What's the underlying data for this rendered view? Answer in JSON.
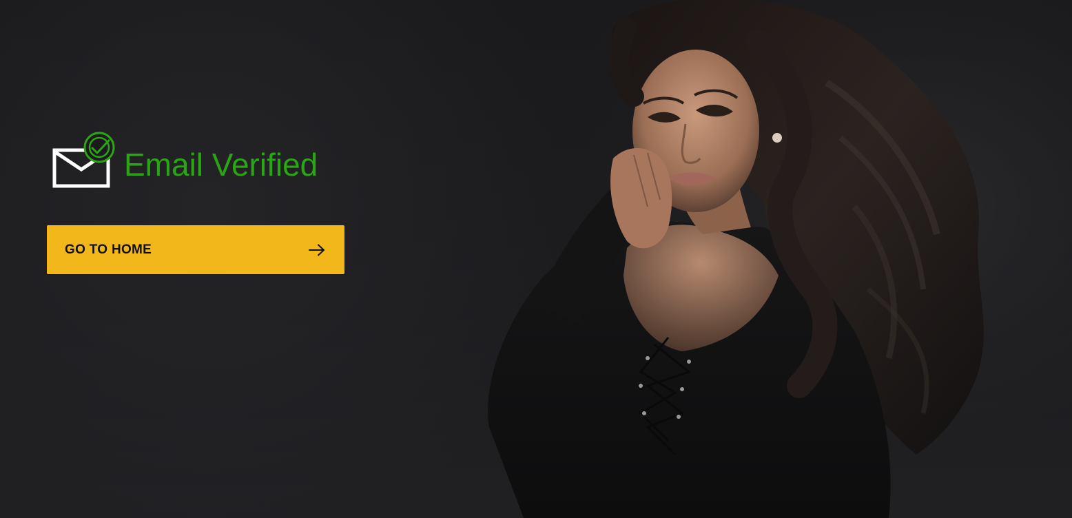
{
  "verification": {
    "title": "Email Verified",
    "icon": "email-verified-icon",
    "status_color": "#2aa614"
  },
  "actions": {
    "home_button_label": "GO TO HOME",
    "home_button_icon": "arrow-right-icon",
    "accent_color": "#f2b71b"
  },
  "hero": {
    "image": "woman-in-black-dress-photo"
  }
}
